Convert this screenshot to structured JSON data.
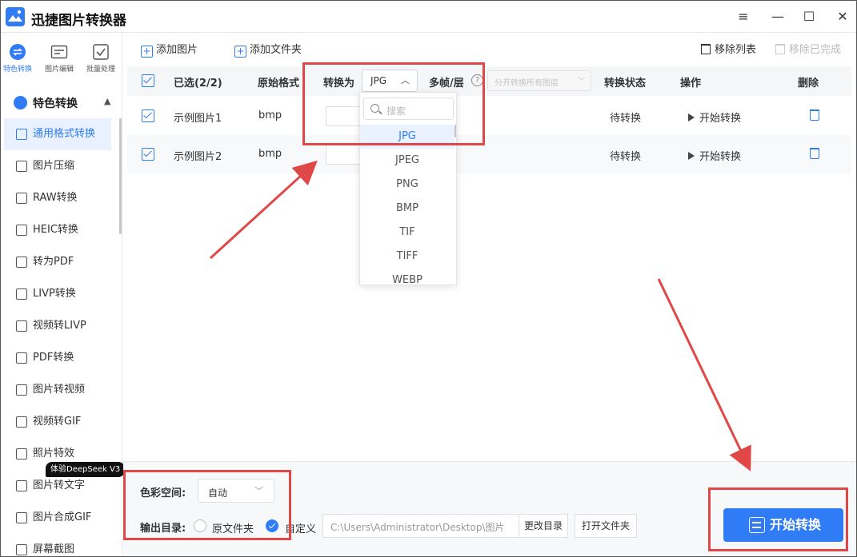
{
  "app": {
    "title": "迅捷图片转换器"
  },
  "window_controls": {
    "menu": "≡",
    "minimize": "—",
    "maximize": "☐",
    "close": "✕"
  },
  "sidebar": {
    "top_tabs": [
      {
        "label": "特色转换",
        "icon": "feature-convert-icon"
      },
      {
        "label": "图片编辑",
        "icon": "image-edit-icon"
      },
      {
        "label": "批量处理",
        "icon": "batch-process-icon"
      }
    ],
    "section_title": "特色转换",
    "items": [
      {
        "label": "通用格式转换"
      },
      {
        "label": "图片压缩"
      },
      {
        "label": "RAW转换"
      },
      {
        "label": "HEIC转换"
      },
      {
        "label": "转为PDF"
      },
      {
        "label": "LIVP转换"
      },
      {
        "label": "视频转LIVP"
      },
      {
        "label": "PDF转换"
      },
      {
        "label": "图片转视频"
      },
      {
        "label": "视频转GIF"
      },
      {
        "label": "照片特效"
      },
      {
        "label": "图片转文字"
      },
      {
        "label": "图片合成GIF"
      },
      {
        "label": "屏幕截图"
      }
    ],
    "badge": "体验DeepSeek V3"
  },
  "toolbar": {
    "add_image": "添加图片",
    "add_folder": "添加文件夹",
    "remove_list": "移除列表",
    "remove_done": "移除已完成"
  },
  "table": {
    "headers": {
      "selected": "已选(2/2)",
      "original_format": "原始格式",
      "convert_to": "转换为",
      "convert_value": "JPG",
      "multi_frame": "多帧/层",
      "layer_placeholder": "分开转换所有图层",
      "status": "转换状态",
      "action": "操作",
      "delete": "删除"
    },
    "rows": [
      {
        "name": "示例图片1",
        "format": "bmp",
        "status": "待转换",
        "action": "开始转换"
      },
      {
        "name": "示例图片2",
        "format": "bmp",
        "status": "待转换",
        "action": "开始转换"
      }
    ]
  },
  "dropdown": {
    "search_placeholder": "搜索",
    "options": [
      "JPG",
      "JPEG",
      "PNG",
      "BMP",
      "TIF",
      "TIFF",
      "WEBP"
    ],
    "selected": "JPG"
  },
  "bottom": {
    "color_space_label": "色彩空间:",
    "color_space_value": "自动",
    "output_label": "输出目录:",
    "option_original": "原文件夹",
    "option_custom": "自定义",
    "path": "C:\\Users\\Administrator\\Desktop\\图片",
    "change_dir": "更改目录",
    "open_folder": "打开文件夹",
    "start": "开始转换"
  },
  "colors": {
    "accent": "#2f7cf6",
    "annotation": "#e04848"
  }
}
